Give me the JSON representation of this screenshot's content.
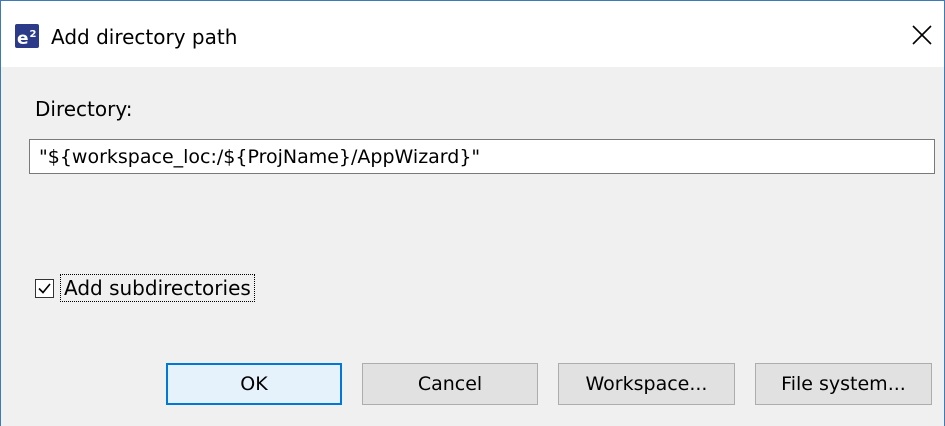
{
  "dialog": {
    "app_icon_text": "e",
    "app_icon_sup": "2",
    "title": "Add directory path",
    "directory_label": "Directory:",
    "directory_value": "\"${workspace_loc:/${ProjName}/AppWizard}\"",
    "add_subdirectories_label": "Add subdirectories",
    "add_subdirectories_checked": true,
    "buttons": {
      "ok": "OK",
      "cancel": "Cancel",
      "workspace": "Workspace...",
      "file_system": "File system..."
    }
  },
  "colors": {
    "accent": "#0078d7",
    "app_icon_bg": "#2b3b8a",
    "window_border": "#3d7ab8"
  }
}
